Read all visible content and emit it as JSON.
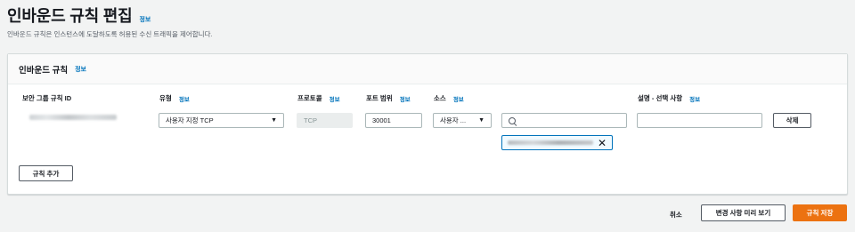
{
  "page": {
    "title": "인바운드 규칙 편집",
    "info": "정보",
    "description": "인바운드 규칙은 인스턴스에 도달하도록 허용된 수신 트래픽을 제어합니다."
  },
  "panel": {
    "title": "인바운드 규칙",
    "info": "정보",
    "columns": {
      "rule_id": "보안 그룹 규칙 ID",
      "type": "유형",
      "protocol": "프로토콜",
      "port_range": "포트 범위",
      "source": "소스",
      "description": "설명 - 선택 사항",
      "info": "정보"
    },
    "rule": {
      "type_value": "사용자 지정 TCP",
      "protocol_value": "TCP",
      "port_value": "30001",
      "source_value": "사용자 ...",
      "search_value": "",
      "description_value": "",
      "delete_label": "삭제"
    },
    "add_rule_label": "규칙 추가"
  },
  "footer": {
    "cancel_label": "취소",
    "preview_label": "변경 사항 미리 보기",
    "save_label": "규칙 저장"
  },
  "colors": {
    "primary": "#ec7211",
    "link": "#0073bb"
  }
}
